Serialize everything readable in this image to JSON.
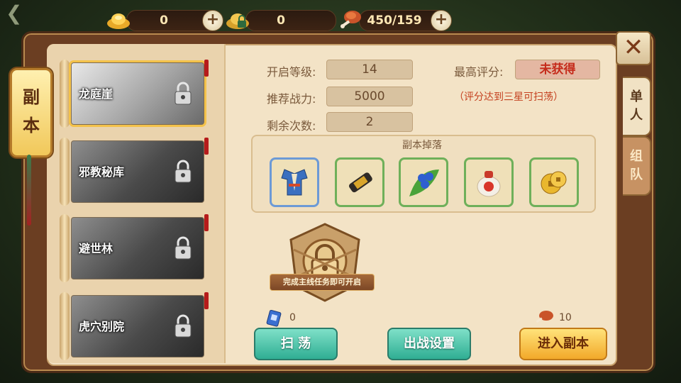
{
  "resources": [
    {
      "icon": "gold-ingot-icon",
      "value": "0"
    },
    {
      "icon": "locked-ingot-icon",
      "value": "0"
    },
    {
      "icon": "drumstick-icon",
      "value": "450/159"
    }
  ],
  "banner": {
    "line1": "副",
    "line2": "本"
  },
  "tabs": [
    {
      "c1": "单",
      "c2": "人",
      "active": true
    },
    {
      "c1": "组",
      "c2": "队",
      "active": false
    }
  ],
  "dungeons": [
    {
      "name": "龙庭崖",
      "selected": true,
      "locked": true
    },
    {
      "name": "邪教秘库",
      "selected": false,
      "locked": true
    },
    {
      "name": "避世林",
      "selected": false,
      "locked": true
    },
    {
      "name": "虎穴别院",
      "selected": false,
      "locked": true
    }
  ],
  "info": {
    "open_level_label": "开启等级:",
    "open_level": "14",
    "power_label": "推荐战力:",
    "power": "5000",
    "remaining_label": "剩余次数:",
    "remaining": "2",
    "best_label": "最高评分:",
    "best": "未获得",
    "sweep_hint": "（评分达到三星可扫荡）"
  },
  "drops": {
    "title": "副本掉落",
    "items": [
      "armor-icon",
      "scroll-icon",
      "berry-leaf-icon",
      "medicine-jar-icon",
      "coin-icon"
    ]
  },
  "lock_text": "完成主线任务即可开启",
  "sweep_count": "0",
  "stamina_cost": "10",
  "buttons": {
    "sweep": "扫 荡",
    "battle_setup": "出战设置",
    "enter": "进入副本"
  }
}
